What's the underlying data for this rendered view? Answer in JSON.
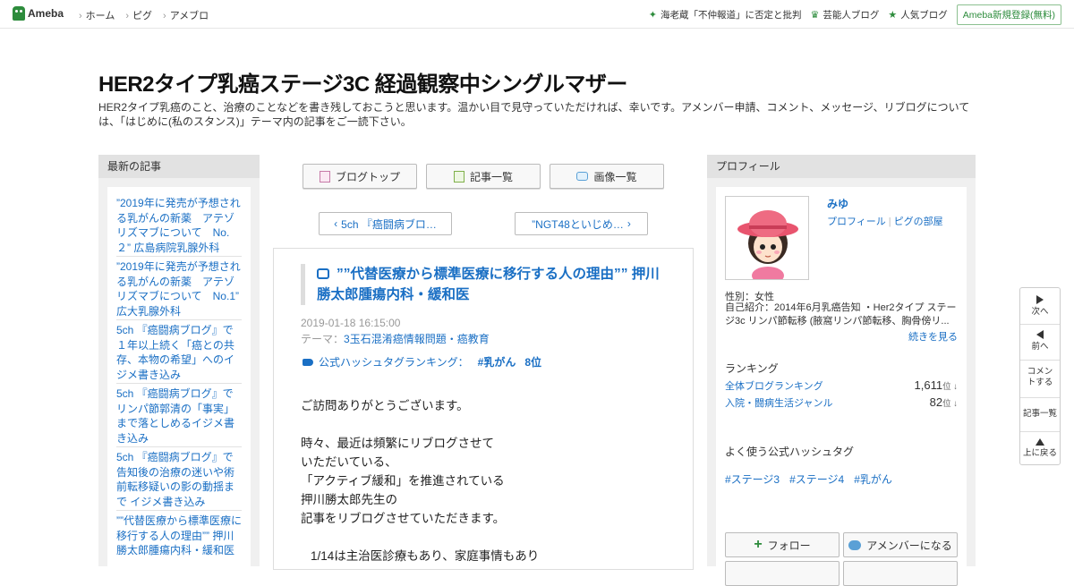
{
  "topbar": {
    "logo": "Ameba",
    "nav": [
      "ホーム",
      "ピグ",
      "アメブロ"
    ],
    "right_links": [
      {
        "icon": "sparkle-icon",
        "label": "海老蔵「不仲報道」に否定と批判"
      },
      {
        "icon": "crown-icon",
        "label": "芸能人ブログ"
      },
      {
        "icon": "star-icon",
        "label": "人気ブログ"
      }
    ],
    "register": "Ameba新規登録(無料)"
  },
  "header": {
    "title": "HER2タイプ乳癌ステージ3C 経過観察中シングルマザー",
    "description": "HER2タイプ乳癌のこと、治療のことなどを書き残しておこうと思います。温かい目で見守っていただければ、幸いです。アメンバー申請、コメント、メッセージ、リブログについては、「はじめに(私のスタンス)」テーマ内の記事をご一読下さい。"
  },
  "left": {
    "heading": "最新の記事",
    "items": [
      "”2019年に発売が予想される乳がんの新薬　アテゾリズマブについて　No.２” 広島病院乳腺外科",
      "”2019年に発売が予想される乳がんの新薬　アテゾリズマブについて　No.1” 広大乳腺外科",
      "5ch 『癌闘病ブログ』で１年以上続く「癌との共存、本物の希望」へのイジメ書き込み",
      "5ch 『癌闘病ブログ』でリンパ節郭清の「事実」まで落としめるイジメ書き込み",
      "5ch 『癌闘病ブログ』で告知後の治療の迷いや術前転移疑いの影の動揺まで イジメ書き込み",
      "””代替医療から標準医療に移行する人の理由”” 押川勝太郎腫瘍内科・緩和医"
    ]
  },
  "center": {
    "buttons": [
      {
        "icon": "blog-top-icon",
        "label": "ブログトップ"
      },
      {
        "icon": "article-list-icon",
        "label": "記事一覧"
      },
      {
        "icon": "camera-icon",
        "label": "画像一覧"
      }
    ],
    "prev": "5ch 『癌闘病ブロ…",
    "next": "”NGT48といじめ…"
  },
  "article": {
    "title": "””代替医療から標準医療に移行する人の理由”” 押川勝太郎腫瘍内科・緩和医",
    "date": "2019-01-18 16:15:00",
    "theme_label": "テーマ：",
    "theme": "3玉石混淆癌情報問題・癌教育",
    "hashtag_label": "公式ハッシュタグランキング：",
    "hashtag": "#乳がん",
    "hashtag_rank": "8位",
    "body": [
      "ご訪問ありがとうございます。",
      "",
      "時々、最近は頻繁にリブログさせて",
      "いただいている、",
      "「アクティブ緩和」を推進されている",
      "押川勝太郎先生の",
      "記事をリブログさせていただきます。",
      "",
      "1/14は主治医診療もあり、家庭事情もあり"
    ]
  },
  "right": {
    "heading": "プロフィール",
    "name": "みゆ",
    "link_profile": "プロフィール",
    "link_pig": "ピグの部屋",
    "gender": "性別：女性",
    "intro": "自己紹介：2014年6月乳癌告知 ・Her2タイプ ステージ3c リンパ節転移 (腋窩リンパ節転移、胸骨傍リ...",
    "more": "続きを見る",
    "ranking_heading": "ランキング",
    "rankings": [
      {
        "label": "全体ブログランキング",
        "value": "1,611",
        "unit": "位 ↓"
      },
      {
        "label": "入院・闘病生活ジャンル",
        "value": "82",
        "unit": "位 ↓"
      }
    ],
    "hash_heading": "よく使う公式ハッシュタグ",
    "hashtags": [
      "#ステージ3",
      "#ステージ4",
      "#乳がん"
    ],
    "follow": "フォロー",
    "amember": "アメンバーになる"
  },
  "floatnav": {
    "next": "次へ",
    "prev": "前へ",
    "comment": "コメントする",
    "list": "記事一覧",
    "top": "上に戻る"
  },
  "colors": {
    "link": "#1a6fc4",
    "brand": "#2d8c3c"
  }
}
